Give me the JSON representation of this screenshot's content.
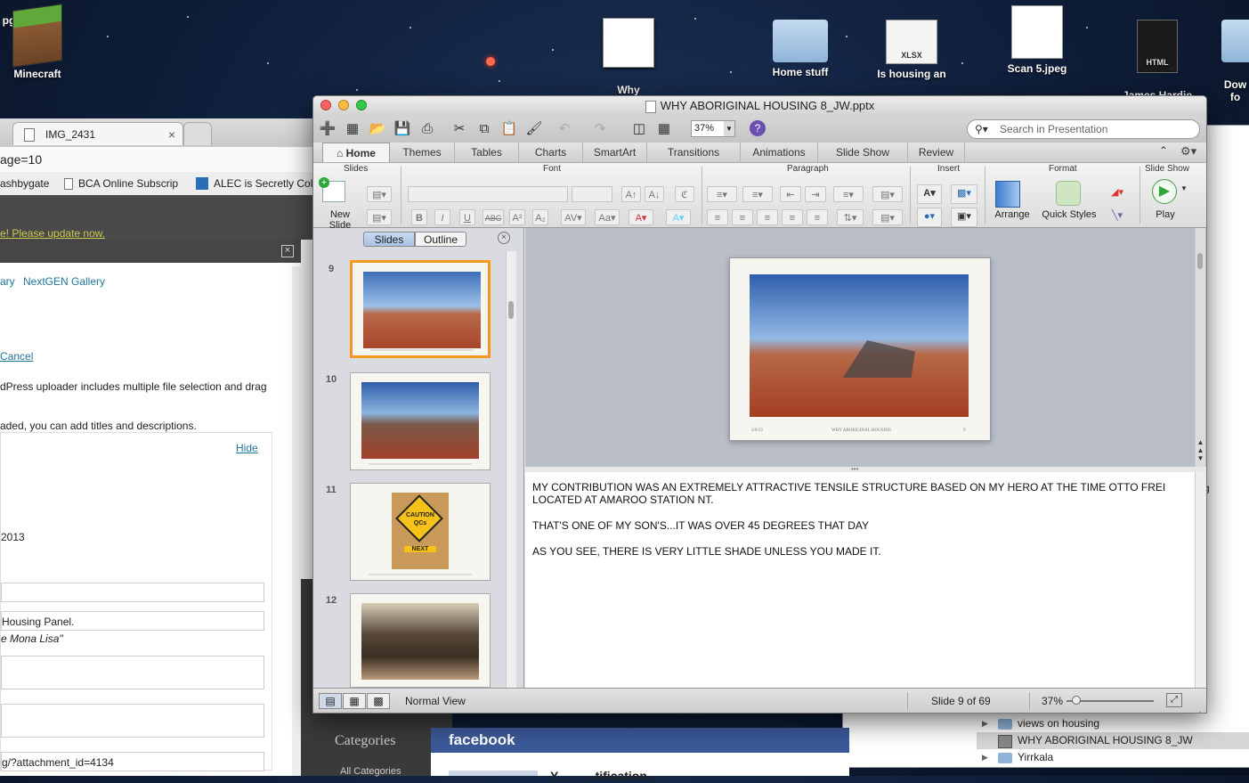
{
  "desktop": {
    "icons": [
      {
        "label": "Minecraft"
      },
      {
        "label": "Why\nAbori…sing?"
      },
      {
        "label": "Home stuff"
      },
      {
        "label": "Is housing an"
      },
      {
        "label": "Scan 5.jpeg"
      },
      {
        "label": "James Hardie\n– Har….html"
      },
      {
        "label": "Dow\nfo"
      },
      {
        "label": "pg"
      }
    ],
    "xlsx_badge": "XLSX",
    "html_badge": "HTML"
  },
  "browser": {
    "tab_title": "IMG_2431",
    "url": "age=10",
    "bookmarks": [
      "ashbygate",
      "BCA Online Subscrip",
      "ALEC is Secretly Col"
    ],
    "update_notice": "e! Please update now.",
    "media_tabs": [
      "ary",
      "NextGEN Gallery"
    ],
    "cancel_link": "Cancel",
    "uploader_text": "dPress uploader includes multiple file selection and drag",
    "uploaded_text": "aded, you can add titles and descriptions.",
    "hide_link": "Hide",
    "date_text": "2013",
    "caption_value": "Housing Panel.",
    "caption_hint": "e Mona Lisa\"",
    "url_value": "g/?attachment_id=4134",
    "categories": "Categories",
    "all_categories": "All Categories"
  },
  "facebook": {
    "title": "facebook",
    "notification": "Y... ... ...tification..."
  },
  "finder": {
    "rows": [
      {
        "label": "views on housing",
        "type": "folder"
      },
      {
        "label": "WHY ABORIGINAL HOUSING 8_JW",
        "type": "file"
      },
      {
        "label": "Yirrkala",
        "type": "folder"
      }
    ],
    "side_char": "g"
  },
  "ppt": {
    "window_title": "WHY ABORIGINAL HOUSING 8_JW.pptx",
    "zoom_box": "37%",
    "search_placeholder": "Search in Presentation",
    "ribbon_tabs": [
      "Home",
      "Themes",
      "Tables",
      "Charts",
      "SmartArt",
      "Transitions",
      "Animations",
      "Slide Show",
      "Review"
    ],
    "groups": {
      "slides": "Slides",
      "font": "Font",
      "paragraph": "Paragraph",
      "insert": "Insert",
      "format": "Format",
      "slideshow": "Slide Show"
    },
    "buttons": {
      "new_slide": "New Slide",
      "arrange": "Arrange",
      "quick_styles": "Quick Styles",
      "play": "Play"
    },
    "pane_tabs": {
      "slides": "Slides",
      "outline": "Outline"
    },
    "thumbnails": [
      {
        "num": "9",
        "kind": "photo-desert"
      },
      {
        "num": "10",
        "kind": "photo-desert-2"
      },
      {
        "num": "11",
        "kind": "photo-sign"
      },
      {
        "num": "12",
        "kind": "photo-house"
      }
    ],
    "sign_text": {
      "caution": "CAUTION",
      "qcs": "QCs",
      "next": "NEXT"
    },
    "slide_footer": {
      "left": "2/9/13",
      "center": "WHY ABORIGINAL HOUSING",
      "right": "9"
    },
    "notes": [
      "MY CONTRIBUTION WAS AN  EXTREMELY ATTRACTIVE TENSILE STRUCTURE BASED ON MY HERO AT THE TIME OTTO FREI LOCATED AT AMAROO STATION NT.",
      "THAT'S ONE OF MY SON'S...IT WAS OVER 45 DEGREES THAT DAY",
      "AS YOU SEE, THERE IS VERY LITTLE SHADE UNLESS YOU MADE IT."
    ],
    "status": {
      "view": "Normal View",
      "slide_pos": "Slide 9 of 69",
      "zoom": "37%"
    },
    "colors": {
      "selection": "#f39a1d",
      "play_green": "#2fa63a",
      "help_purple": "#6b4fb3"
    }
  }
}
